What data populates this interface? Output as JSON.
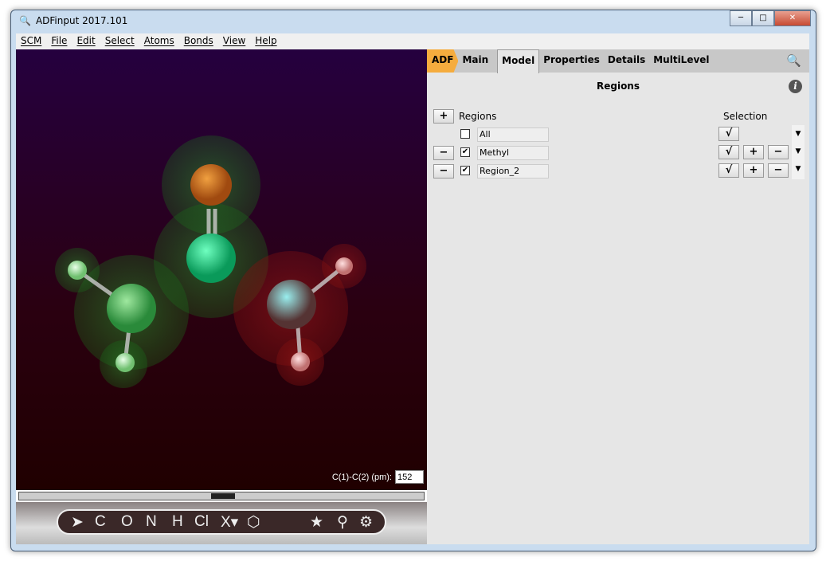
{
  "window": {
    "title": "ADFinput 2017.101",
    "minimize": "─",
    "maximize": "□",
    "close": "✕"
  },
  "menu": [
    "SCM",
    "File",
    "Edit",
    "Select",
    "Atoms",
    "Bonds",
    "View",
    "Help"
  ],
  "viewer": {
    "measure_label": "C(1)-C(2) (pm):",
    "measure_value": "152"
  },
  "toolbar": {
    "tools": [
      "C",
      "O",
      "N",
      "H",
      "Cl",
      "X▾"
    ]
  },
  "panel": {
    "tabs": [
      "ADF",
      "Main",
      "Model",
      "Properties",
      "Details",
      "MultiLevel"
    ],
    "active_tab": "Model",
    "title": "Regions",
    "regions_header": "Regions",
    "selection_header": "Selection",
    "rows": [
      {
        "name": "All",
        "checked": false,
        "check": "√",
        "dropdown": "▼"
      },
      {
        "name": "Methyl",
        "checked": true,
        "check": "√",
        "add": "+",
        "remove": "−",
        "dropdown": "▼"
      },
      {
        "name": "Region_2",
        "checked": true,
        "check": "√",
        "add": "+",
        "remove": "−",
        "dropdown": "▼"
      }
    ],
    "add_button": "+",
    "remove_button": "−"
  },
  "colors": {
    "accent": "#f5ac3e",
    "methyl_region": "#2a9a3a",
    "region_2": "#a01818"
  }
}
